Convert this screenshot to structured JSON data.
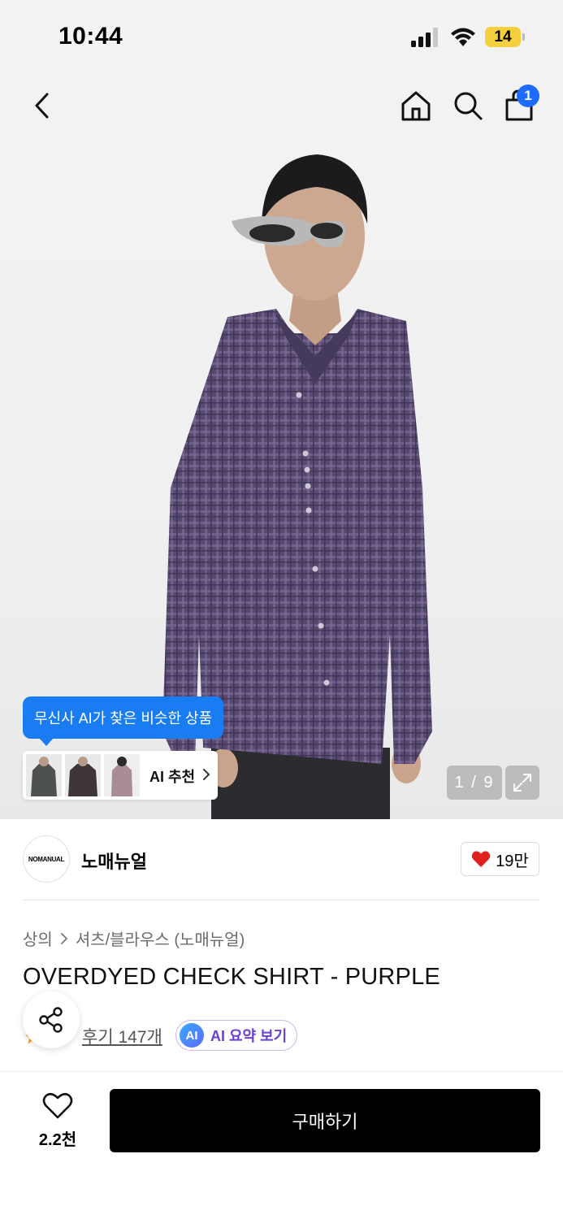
{
  "status_bar": {
    "time": "10:44",
    "battery": "14"
  },
  "nav": {
    "cart_count": "1"
  },
  "gallery": {
    "ai_tooltip": "무신사 AI가 찾은 비슷한 상품",
    "ai_reco_label": "AI 추천",
    "page_indicator": "1 / 9"
  },
  "brand": {
    "logo_text": "NOMANUAL",
    "name": "노매뉴얼",
    "likes": "19만"
  },
  "breadcrumb": {
    "category": "상의",
    "subcategory": "셔츠/블라우스 (노매뉴얼)"
  },
  "product": {
    "title": "OVERDYED CHECK SHIRT - PURPLE"
  },
  "reviews": {
    "link": "후기 147개",
    "ai_badge": "AI",
    "ai_summary": "AI 요약 보기"
  },
  "bottom_bar": {
    "wish_count": "2.2천",
    "buy_label": "구매하기"
  },
  "colors": {
    "accent_blue": "#1a7cf2",
    "badge_blue": "#1e6bff",
    "heart_red": "#e0201f",
    "ai_purple": "#6b3fd4",
    "buy_black": "#000000",
    "shirt_purple": "#5a4a78"
  }
}
